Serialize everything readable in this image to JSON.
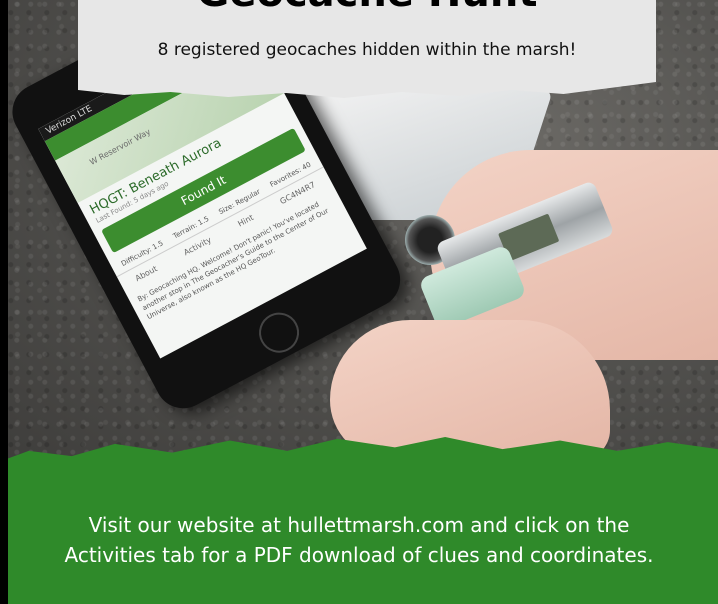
{
  "banner": {
    "title": "Geocache Hunt",
    "subtitle": "8 registered geocaches hidden within the marsh!"
  },
  "phone": {
    "carrier": "Verizon LTE",
    "map_road": "W Reservoir Way",
    "cache_name": "HQGT: Beneath Aurora",
    "last_found": "Last Found: 5 days ago",
    "found_button": "Found It",
    "difficulty": "Difficulty: 1.5",
    "terrain": "Terrain: 1.5",
    "size": "Size: Regular",
    "favorites": "Favorites: 40",
    "tab_about": "About",
    "tab_activity": "Activity",
    "tab_hint": "Hint",
    "code": "GC4N4R7",
    "description": "By: Geocaching HQ. Welcome! Don't panic! You've located another stop in The Geocacher's Guide to the Center of Our Universe, also known as the HQ GeoTour."
  },
  "footer": {
    "text": "Visit our website at hullettmarsh.com and click on the Activities tab for a PDF download of clues and coordinates."
  },
  "colors": {
    "footer_green": "#2f8a2a",
    "banner_gray": "#e7e7e7",
    "app_green": "#3c8d2f"
  }
}
